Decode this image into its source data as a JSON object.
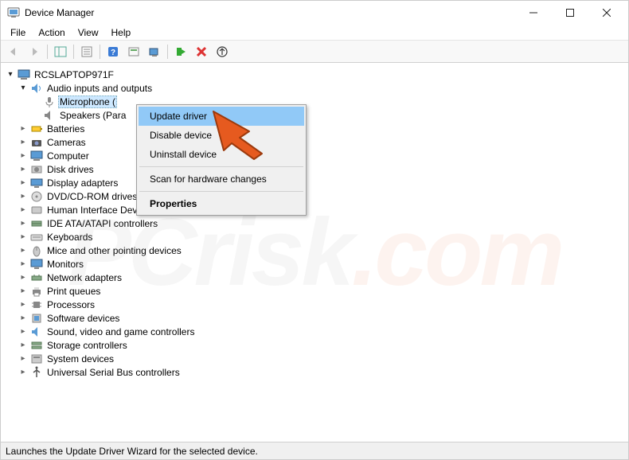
{
  "window": {
    "title": "Device Manager"
  },
  "menu": {
    "file": "File",
    "action": "Action",
    "view": "View",
    "help": "Help"
  },
  "tree": {
    "root": "RCSLAPTOP971F",
    "audio": {
      "label": "Audio inputs and outputs",
      "mic": "Microphone (",
      "speakers": "Speakers (Para"
    },
    "items": [
      "Batteries",
      "Cameras",
      "Computer",
      "Disk drives",
      "Display adapters",
      "DVD/CD-ROM drives",
      "Human Interface Devices",
      "IDE ATA/ATAPI controllers",
      "Keyboards",
      "Mice and other pointing devices",
      "Monitors",
      "Network adapters",
      "Print queues",
      "Processors",
      "Software devices",
      "Sound, video and game controllers",
      "Storage controllers",
      "System devices",
      "Universal Serial Bus controllers"
    ]
  },
  "context": {
    "update": "Update driver",
    "disable": "Disable device",
    "uninstall": "Uninstall device",
    "scan": "Scan for hardware changes",
    "properties": "Properties"
  },
  "status": "Launches the Update Driver Wizard for the selected device."
}
